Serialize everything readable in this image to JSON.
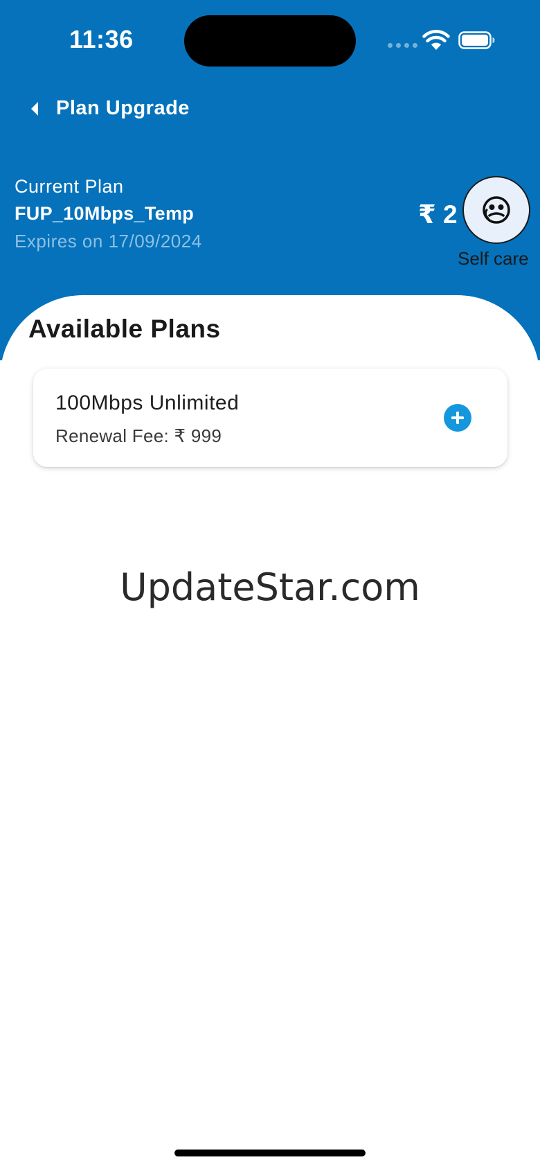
{
  "status_bar": {
    "time": "11:36"
  },
  "nav": {
    "title": "Plan Upgrade",
    "back_icon": "chevron-left-icon"
  },
  "current_plan": {
    "label": "Current Plan",
    "name": "FUP_10Mbps_Temp",
    "expiry": "Expires on 17/09/2024",
    "price": "₹ 2"
  },
  "self_care": {
    "label": "Self care",
    "icon": "support-face-icon"
  },
  "available_plans": {
    "title": "Available Plans",
    "plans": [
      {
        "name": "100Mbps Unlimited",
        "fee_label": "Renewal Fee: ₹ 999",
        "action_icon": "plus-circle-icon"
      }
    ]
  },
  "watermark": {
    "text": "UpdateStar.com"
  },
  "colors": {
    "header_blue": "#0572bb",
    "accent_blue": "#1597de",
    "expiry_text": "#8fc0e4",
    "selfcare_bg": "#e7f0fb"
  }
}
